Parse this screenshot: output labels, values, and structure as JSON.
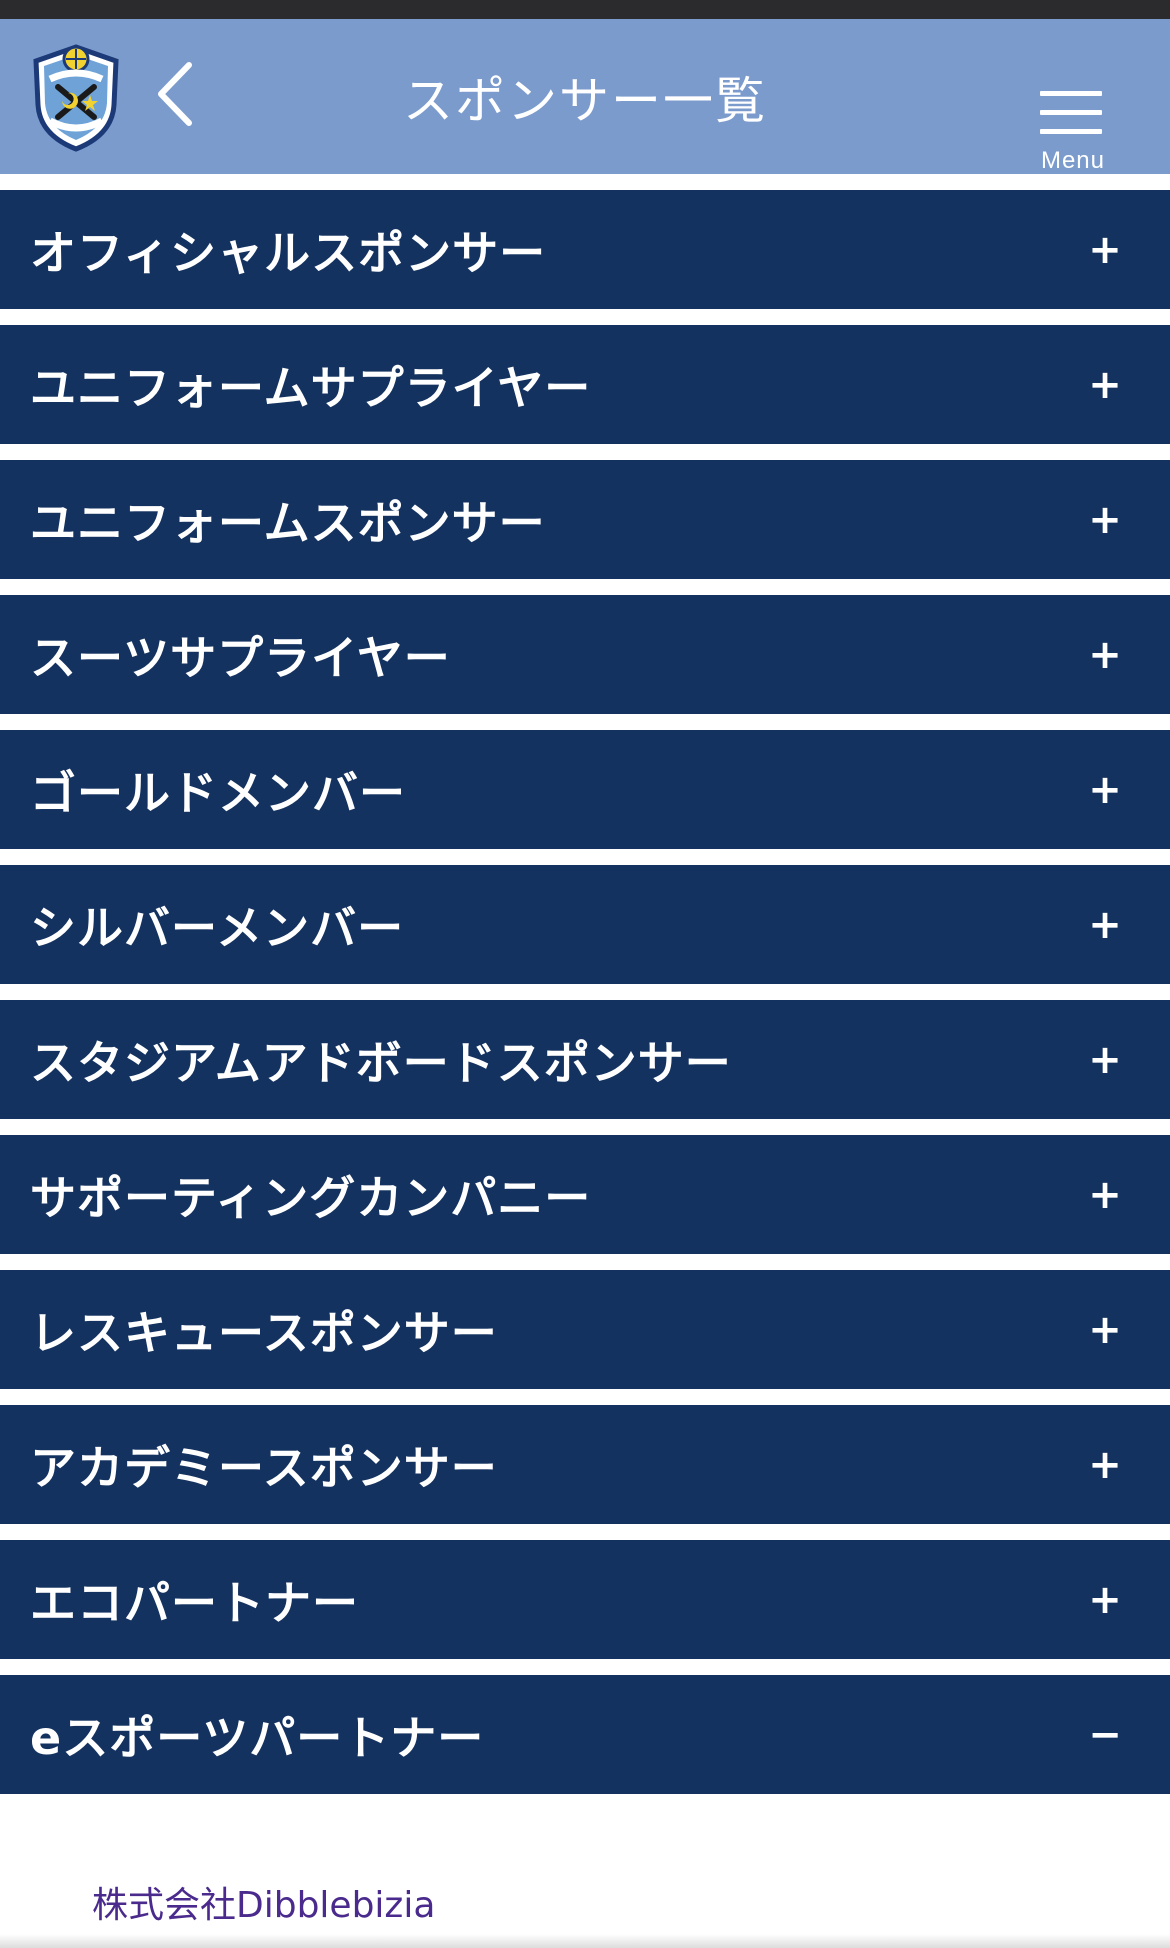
{
  "header": {
    "title": "スポンサー一覧",
    "menu_label": "Menu",
    "logo_icon": "jubilo-iwata-crest-icon",
    "back_icon": "chevron-left-icon",
    "menu_icon": "hamburger-icon"
  },
  "colors": {
    "header_bg": "#7b9bcd",
    "category_bg": "#14325f",
    "link_text": "#4a2a8c"
  },
  "categories": [
    {
      "label": "オフィシャルスポンサー",
      "toggle": "+"
    },
    {
      "label": "ユニフォームサプライヤー",
      "toggle": "+"
    },
    {
      "label": "ユニフォームスポンサー",
      "toggle": "+"
    },
    {
      "label": "スーツサプライヤー",
      "toggle": "+"
    },
    {
      "label": "ゴールドメンバー",
      "toggle": "+"
    },
    {
      "label": "シルバーメンバー",
      "toggle": "+"
    },
    {
      "label": "スタジアムアドボードスポンサー",
      "toggle": "+"
    },
    {
      "label": "サポーティングカンパニー",
      "toggle": "+"
    },
    {
      "label": "レスキュースポンサー",
      "toggle": "+"
    },
    {
      "label": "アカデミースポンサー",
      "toggle": "+"
    },
    {
      "label": "エコパートナー",
      "toggle": "+"
    },
    {
      "label": "eスポーツパートナー",
      "toggle": "−"
    }
  ],
  "expanded_section": {
    "sponsors": [
      "株式会社Dibblebizia"
    ]
  }
}
